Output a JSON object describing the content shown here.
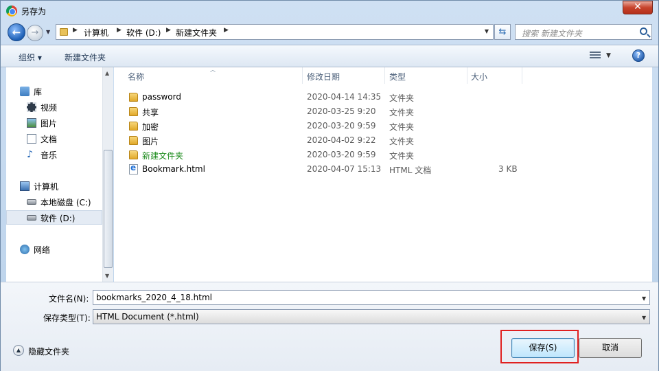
{
  "window": {
    "title": "另存为",
    "close_label": "✕"
  },
  "address": {
    "crumbs": [
      "计算机",
      "软件 (D:)",
      "新建文件夹"
    ],
    "search_placeholder": "搜索 新建文件夹"
  },
  "toolbar": {
    "organize_label": "组织 ▾",
    "new_folder_label": "新建文件夹",
    "help_label": "?"
  },
  "nav": {
    "libraries": "库",
    "library_items": [
      "视频",
      "图片",
      "文档",
      "音乐"
    ],
    "computer": "计算机",
    "drives": [
      "本地磁盘 (C:)",
      "软件 (D:)"
    ],
    "network": "网络"
  },
  "columns": {
    "name": "名称",
    "date": "修改日期",
    "type": "类型",
    "size": "大小"
  },
  "files": [
    {
      "name": "password",
      "date": "2020-04-14 14:35",
      "type": "文件夹",
      "size": "",
      "kind": "folder"
    },
    {
      "name": "共享",
      "date": "2020-03-25 9:20",
      "type": "文件夹",
      "size": "",
      "kind": "folder"
    },
    {
      "name": "加密",
      "date": "2020-03-20 9:59",
      "type": "文件夹",
      "size": "",
      "kind": "folder"
    },
    {
      "name": "图片",
      "date": "2020-04-02 9:22",
      "type": "文件夹",
      "size": "",
      "kind": "folder"
    },
    {
      "name": "新建文件夹",
      "date": "2020-03-20 9:59",
      "type": "文件夹",
      "size": "",
      "kind": "folder",
      "color": "#1a8a1a"
    },
    {
      "name": "Bookmark.html",
      "date": "2020-04-07 15:13",
      "type": "HTML 文档",
      "size": "3 KB",
      "kind": "html"
    }
  ],
  "form": {
    "filename_label": "文件名(N):",
    "filename_value": "bookmarks_2020_4_18.html",
    "filetype_label": "保存类型(T):",
    "filetype_value": "HTML Document (*.html)"
  },
  "footer": {
    "hide_folders_label": "隐藏文件夹",
    "save_label": "保存(S)",
    "cancel_label": "取消"
  }
}
